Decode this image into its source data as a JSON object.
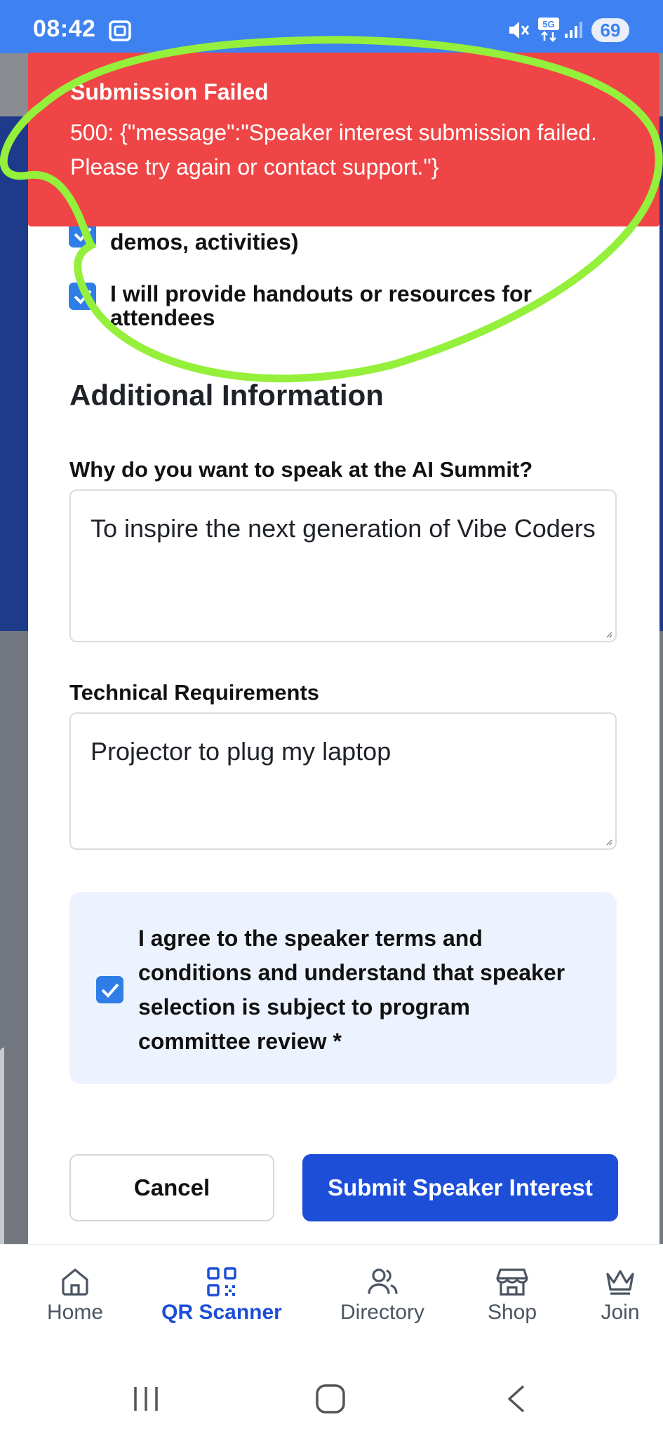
{
  "status_bar": {
    "time": "08:42",
    "battery": "69"
  },
  "toast": {
    "title": "Submission Failed",
    "message": "500: {\"message\":\"Speaker interest submission failed. Please try again or contact support.\"}",
    "color": "#ef4546"
  },
  "form": {
    "checkbox_partial": "demos, activities)",
    "checkbox_handouts": "I will provide handouts or resources for attendees",
    "section_title": "Additional Information",
    "why_label": "Why do you want to speak at the AI Summit?",
    "why_value": "To inspire the next generation of Vibe Coders",
    "tech_label": "Technical Requirements",
    "tech_value": "Projector to plug my laptop",
    "agree_text": "I agree to the speaker terms and conditions and understand that speaker selection is subject to program committee review *",
    "cancel_label": "Cancel",
    "submit_label": "Submit Speaker Interest",
    "accent_color": "#1d4ed8"
  },
  "bottom_nav": {
    "items": [
      {
        "label": "Home",
        "icon": "home-icon"
      },
      {
        "label": "QR Scanner",
        "icon": "qr-code-icon",
        "active": true
      },
      {
        "label": "Directory",
        "icon": "users-icon"
      },
      {
        "label": "Shop",
        "icon": "store-icon"
      },
      {
        "label": "Join",
        "icon": "crown-icon"
      }
    ]
  }
}
